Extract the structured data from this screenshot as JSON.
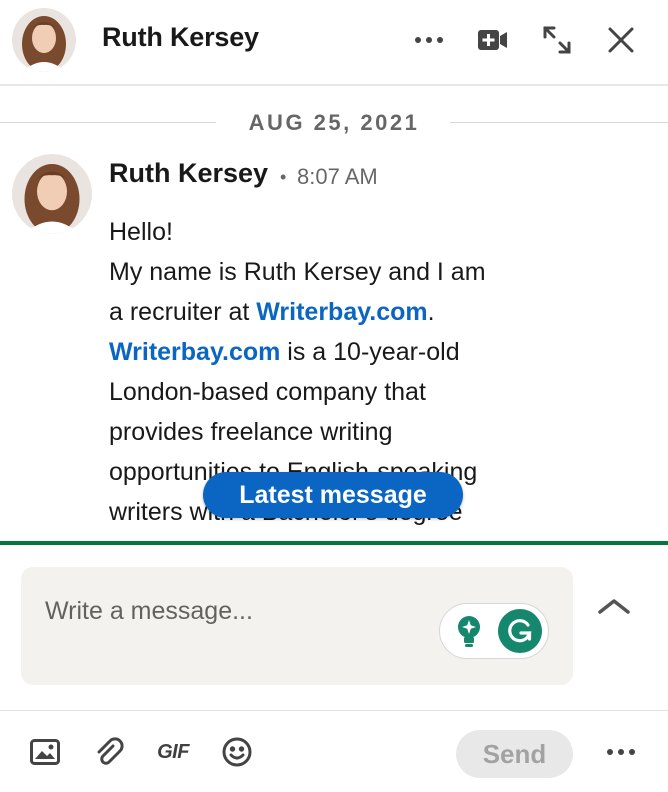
{
  "header": {
    "contact_name": "Ruth Kersey",
    "icons": [
      "more-options-icon",
      "video-call-icon",
      "expand-window-icon",
      "close-icon"
    ]
  },
  "conversation": {
    "date_divider": "AUG 25, 2021",
    "message": {
      "sender": "Ruth Kersey",
      "separator": "•",
      "time": "8:07 AM",
      "lines": {
        "l1": "Hello!",
        "l2": "My name is Ruth Kersey and I am",
        "l3_pre": "a recruiter at ",
        "l3_link": "Writerbay.com",
        "l3_post": ".",
        "l4_link": "Writerbay.com",
        "l4_post": " is a 10-year-old",
        "l5": "London-based company that",
        "l6": "provides freelance writing",
        "l7": "opportunities to English-speaking",
        "l8": "writers with a Bachelor's degree"
      }
    },
    "latest_message_button": "Latest message"
  },
  "compose": {
    "placeholder": "Write a message...",
    "grammarly_letter": "G"
  },
  "toolbar": {
    "gif_label": "GIF",
    "send_label": "Send",
    "icons": [
      "image-icon",
      "attachment-icon",
      "gif-icon",
      "emoji-icon",
      "more-options-icon"
    ]
  },
  "colors": {
    "link": "#0a66c2",
    "accent_green": "#057642",
    "grammarly": "#15876d",
    "compose_bg": "#f3f2ef"
  }
}
